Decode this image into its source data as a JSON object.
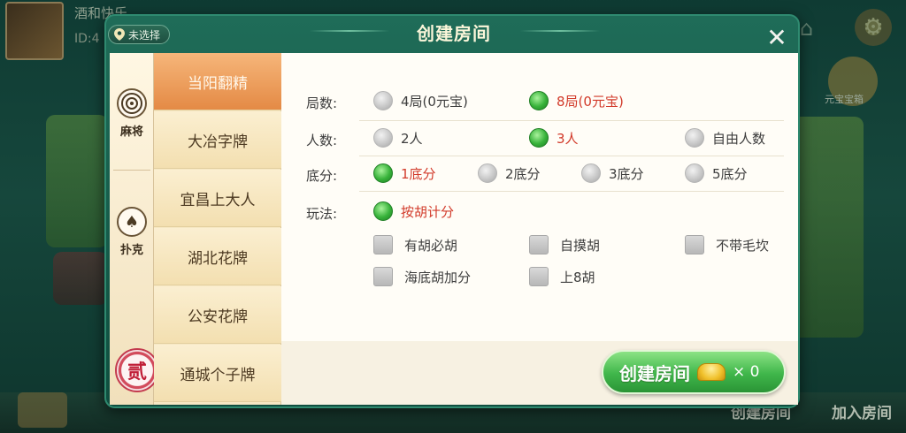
{
  "background": {
    "player_name": "酒和快乐",
    "player_id": "ID:4",
    "right_label": "元宝宝箱",
    "bottom_create": "创建房间",
    "bottom_join": "加入房间"
  },
  "modal": {
    "title": "创建房间",
    "location": "未选择",
    "close_glyph": "✕",
    "categories": [
      {
        "label": "麻将",
        "icon": "mahjong-coin-icon"
      },
      {
        "label": "扑克",
        "icon": "spade-icon"
      },
      {
        "label": "",
        "icon": "seal-er-icon",
        "seal_char": "贰"
      }
    ],
    "games": [
      "当阳翻精",
      "大冶字牌",
      "宜昌上大人",
      "湖北花牌",
      "公安花牌",
      "通城个子牌"
    ],
    "active_game_index": 0,
    "rounds": {
      "label": "局数:",
      "options": [
        {
          "text": "4局(0元宝)",
          "selected": false
        },
        {
          "text": "8局(0元宝)",
          "selected": true
        }
      ]
    },
    "players": {
      "label": "人数:",
      "options": [
        {
          "text": "2人",
          "selected": false
        },
        {
          "text": "3人",
          "selected": true
        },
        {
          "text": "自由人数",
          "selected": false
        }
      ]
    },
    "base": {
      "label": "底分:",
      "options": [
        {
          "text": "1底分",
          "selected": true
        },
        {
          "text": "2底分",
          "selected": false
        },
        {
          "text": "3底分",
          "selected": false
        },
        {
          "text": "5底分",
          "selected": false
        }
      ]
    },
    "play": {
      "label": "玩法:",
      "mode": {
        "text": "按胡计分",
        "selected": true
      },
      "checks": [
        {
          "text": "有胡必胡",
          "checked": false
        },
        {
          "text": "自摸胡",
          "checked": false
        },
        {
          "text": "不带毛坎",
          "checked": false
        },
        {
          "text": "海底胡加分",
          "checked": false
        },
        {
          "text": "上8胡",
          "checked": false
        }
      ]
    },
    "create_button": {
      "label": "创建房间",
      "cost": "× 0"
    }
  },
  "colors": {
    "selected_text": "#d23a2a",
    "radio_on": "#37b23a",
    "active_tab": "#e48a45",
    "modal_frame": "#1f6c58"
  }
}
